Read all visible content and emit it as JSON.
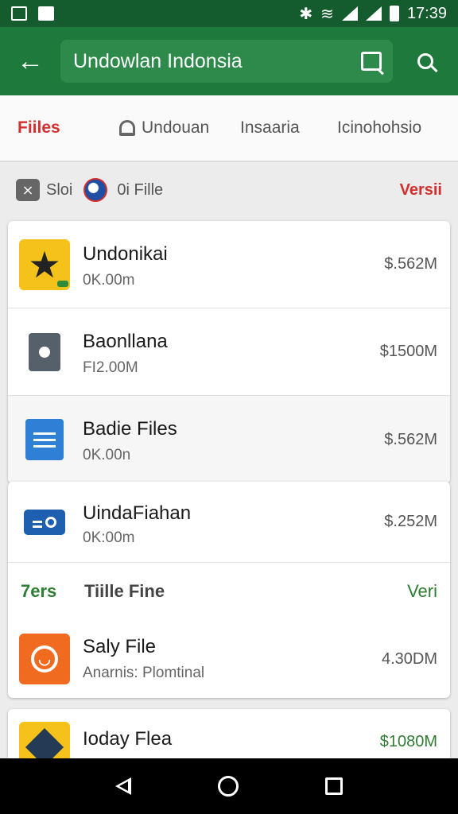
{
  "status_bar": {
    "time": "17:39",
    "bluetooth_icon": "bluetooth-icon",
    "wifi_icon": "wifi-icon"
  },
  "app_bar": {
    "search_text": "Undowlan Indonsia"
  },
  "tabs": [
    "Fiiles",
    "Undouan",
    "Insaaria",
    "Icinohohsio"
  ],
  "filter": {
    "sort_label": "Sloi",
    "file_label": "0i Fille",
    "version_label": "Versii"
  },
  "card1": [
    {
      "name": "Undonikai",
      "sub": "0K.00m",
      "size": "$.562M"
    },
    {
      "name": "Baonllana",
      "sub": "FI2.00M",
      "size": "$1500M"
    },
    {
      "name": "Badie Files",
      "sub": "0K.00n",
      "size": "$.562M"
    }
  ],
  "card2": {
    "row": {
      "name": "UindaFiahan",
      "sub": "0K:00m",
      "size": "$.252M"
    },
    "section": {
      "left": "7ers",
      "title": "Tiille Fine",
      "right": "Veri"
    },
    "row2": {
      "name": "Saly File",
      "sub": "Anarnis: Plomtinal",
      "size": "4.30DM"
    }
  },
  "card3": {
    "name": "Ioday Flea",
    "size": "$1080M"
  },
  "colors": {
    "app_bar": "#1d7a3c",
    "status_bar": "#145c2e",
    "accent_red": "#d32f2f",
    "accent_green": "#2e7d32"
  }
}
